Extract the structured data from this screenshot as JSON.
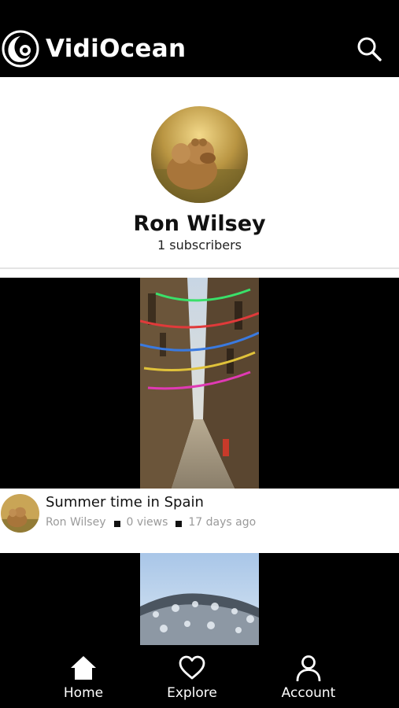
{
  "header": {
    "app_title": "VidiOcean",
    "logo_icon": "vidiocean-logo",
    "search_icon": "search-icon"
  },
  "profile": {
    "name": "Ron Wilsey",
    "subscribers": "1 subscribers",
    "avatar": "lioness-avatar"
  },
  "videos": [
    {
      "title": "Summer time in Spain",
      "author": "Ron Wilsey",
      "views": "0 views",
      "age": "17 days ago",
      "thumbnail": "street-with-bunting-flags"
    },
    {
      "thumbnail": "snowy-forest-hill"
    }
  ],
  "bottom_nav": {
    "items": [
      {
        "label": "Home",
        "icon": "home-icon"
      },
      {
        "label": "Explore",
        "icon": "heart-icon"
      },
      {
        "label": "Account",
        "icon": "user-icon"
      }
    ]
  }
}
